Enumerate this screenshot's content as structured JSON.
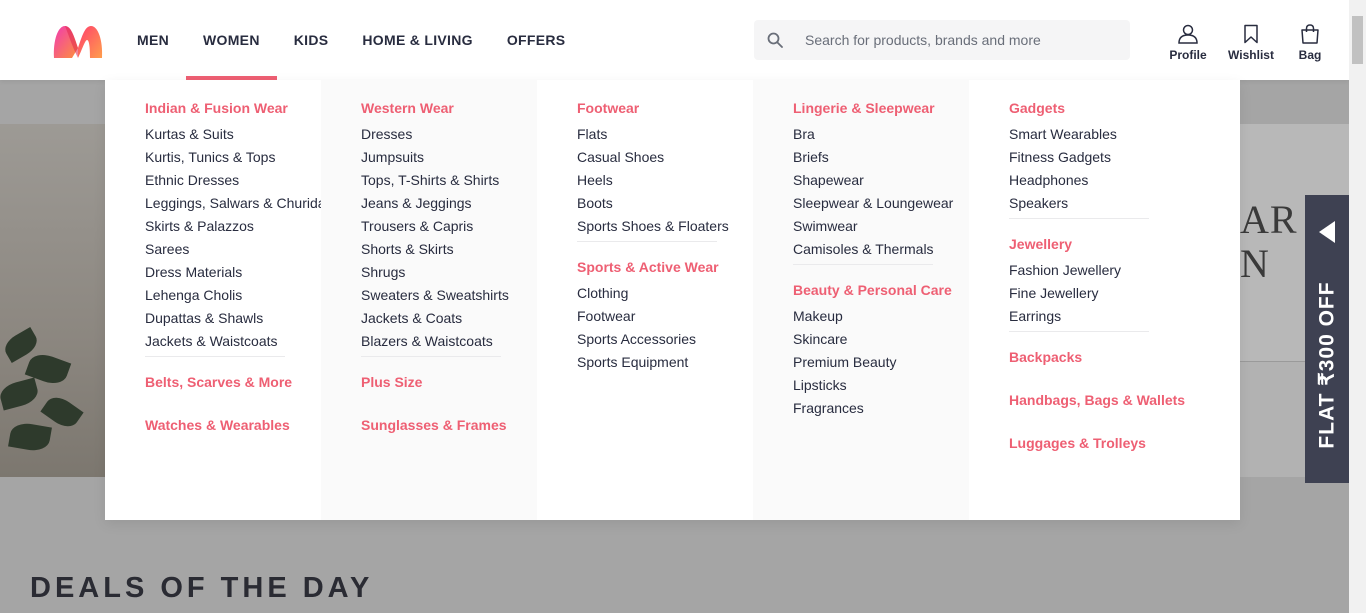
{
  "header": {
    "nav": [
      {
        "label": "MEN",
        "active": false
      },
      {
        "label": "WOMEN",
        "active": true
      },
      {
        "label": "KIDS",
        "active": false
      },
      {
        "label": "HOME & LIVING",
        "active": false
      },
      {
        "label": "OFFERS",
        "active": false
      }
    ],
    "search": {
      "placeholder": "Search for products, brands and more"
    },
    "actions": {
      "profile": "Profile",
      "wishlist": "Wishlist",
      "bag": "Bag"
    }
  },
  "menu": {
    "col1": {
      "c1_title": "Indian & Fusion Wear",
      "c1_items": [
        "Kurtas & Suits",
        "Kurtis, Tunics & Tops",
        "Ethnic Dresses",
        "Leggings, Salwars & Churidars",
        "Skirts & Palazzos",
        "Sarees",
        "Dress Materials",
        "Lehenga Cholis",
        "Dupattas & Shawls",
        "Jackets & Waistcoats"
      ],
      "c2_title": "Belts, Scarves & More",
      "c3_title": "Watches & Wearables"
    },
    "col2": {
      "c1_title": "Western Wear",
      "c1_items": [
        "Dresses",
        "Jumpsuits",
        "Tops, T-Shirts & Shirts",
        "Jeans & Jeggings",
        "Trousers & Capris",
        "Shorts & Skirts",
        "Shrugs",
        "Sweaters & Sweatshirts",
        "Jackets & Coats",
        "Blazers & Waistcoats"
      ],
      "c2_title": "Plus Size",
      "c3_title": "Sunglasses & Frames"
    },
    "col3": {
      "c1_title": "Footwear",
      "c1_items": [
        "Flats",
        "Casual Shoes",
        "Heels",
        "Boots",
        "Sports Shoes & Floaters"
      ],
      "c2_title": "Sports & Active Wear",
      "c2_items": [
        "Clothing",
        "Footwear",
        "Sports Accessories",
        "Sports Equipment"
      ]
    },
    "col4": {
      "c1_title": "Lingerie & Sleepwear",
      "c1_items": [
        "Bra",
        "Briefs",
        "Shapewear",
        "Sleepwear & Loungewear",
        "Swimwear",
        "Camisoles & Thermals"
      ],
      "c2_title": "Beauty & Personal Care",
      "c2_items": [
        "Makeup",
        "Skincare",
        "Premium Beauty",
        "Lipsticks",
        "Fragrances"
      ]
    },
    "col5": {
      "c1_title": "Gadgets",
      "c1_items": [
        "Smart Wearables",
        "Fitness Gadgets",
        "Headphones",
        "Speakers"
      ],
      "c2_title": "Jewellery",
      "c2_items": [
        "Fashion Jewellery",
        "Fine Jewellery",
        "Earrings"
      ],
      "c3_title": "Backpacks",
      "c4_title": "Handbags, Bags & Wallets",
      "c5_title": "Luggages & Trolleys"
    }
  },
  "background": {
    "hero_text_line1": "AR",
    "hero_text_line2": "N",
    "deals_title": "DEALS OF THE DAY"
  },
  "promo": {
    "label": "FLAT ₹300 OFF"
  },
  "colors": {
    "accent": "#ee5f73",
    "text": "#282c3f",
    "promo_bg": "#3e4152"
  },
  "icons": {
    "logo": "myntra-logo",
    "search": "search-icon",
    "profile": "profile-icon",
    "wishlist": "wishlist-icon",
    "bag": "bag-icon",
    "promo_arrow": "left-arrow-icon"
  }
}
